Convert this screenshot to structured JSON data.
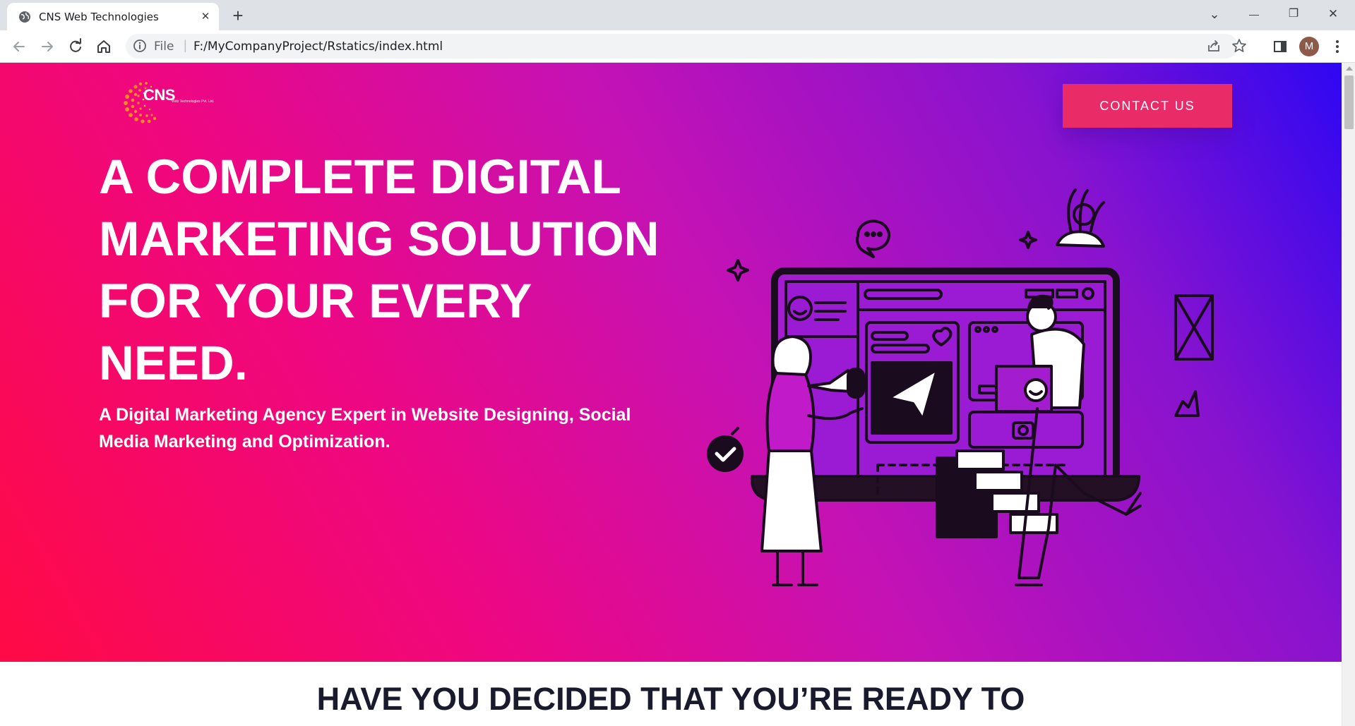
{
  "browser": {
    "tab_title": "CNS Web Technologies",
    "tab_close_glyph": "✕",
    "new_tab_glyph": "+",
    "window_controls": {
      "dropdown": "⌄",
      "minimize": "—",
      "restore": "❐",
      "close": "✕"
    },
    "address_label": "File",
    "address_separator": "|",
    "url": "F:/MyCompanyProject/Rstatics/index.html",
    "profile_initial": "M",
    "icons": [
      "back-icon",
      "forward-icon",
      "reload-icon",
      "home-icon",
      "info-icon",
      "share-icon",
      "star-icon",
      "side-panel-icon",
      "kebab-menu-icon"
    ]
  },
  "hero": {
    "logo": {
      "name": "CNS",
      "subtitle": "Web Technologies Pvt. Ltd."
    },
    "contact_label": "CONTACT US",
    "headline_lines": [
      "A COMPLETE DIGITAL",
      "MARKETING SOLUTION",
      "FOR YOUR EVERY",
      "NEED."
    ],
    "subheadline": "A Digital Marketing Agency Expert in Website Designing, Social Media Marketing and Optimization.",
    "colors": {
      "gradient_start": "#ff0a45",
      "gradient_mid": "#c412b5",
      "gradient_end": "#2e07f2",
      "button": "#e92b67"
    }
  },
  "section": {
    "title": "HAVE YOU DECIDED THAT YOU’RE READY TO"
  }
}
